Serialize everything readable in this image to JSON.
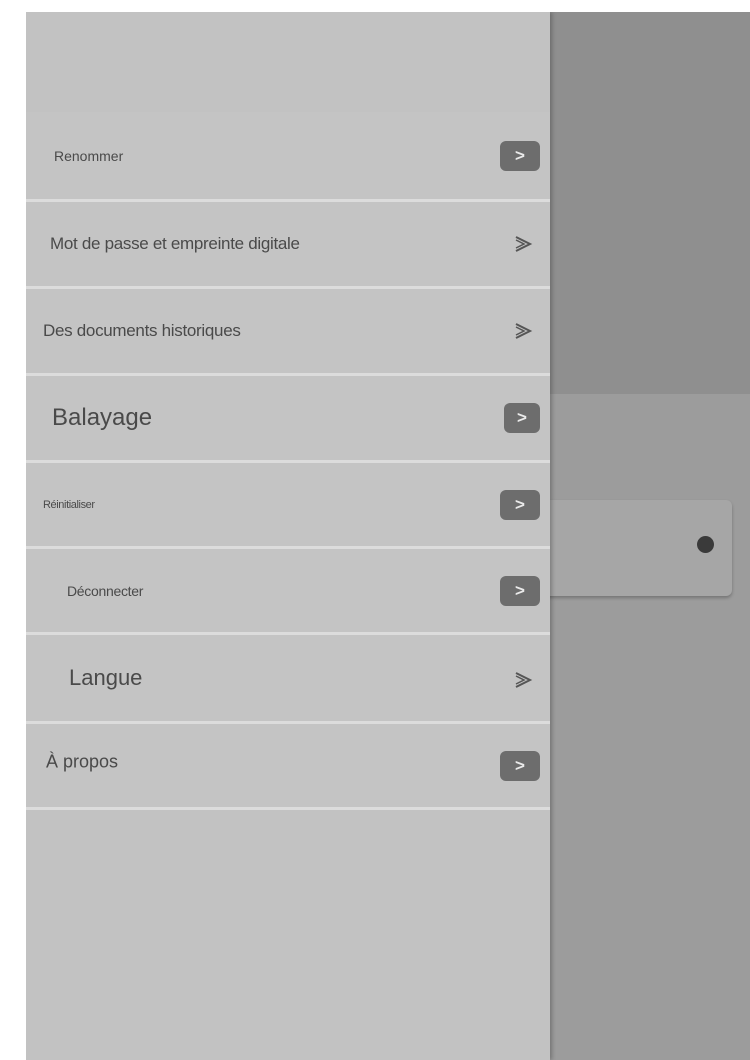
{
  "menu": {
    "items": [
      {
        "label": "Renommer"
      },
      {
        "label": "Mot de passe et empreinte digitale"
      },
      {
        "label": "Des documents historiques"
      },
      {
        "label": "Balayage"
      },
      {
        "label": "Réinitialiser"
      },
      {
        "label": "Déconnecter"
      },
      {
        "label": "Langue"
      },
      {
        "label": "À propos"
      }
    ],
    "chevron_symbol": ">",
    "chevron_icon": "chevron-right-icon"
  },
  "colors": {
    "drawer_bg": "#c4c4c4",
    "divider": "#dcdcdc",
    "chevron_button": "#6d6d6d",
    "overlay": "#979797"
  }
}
